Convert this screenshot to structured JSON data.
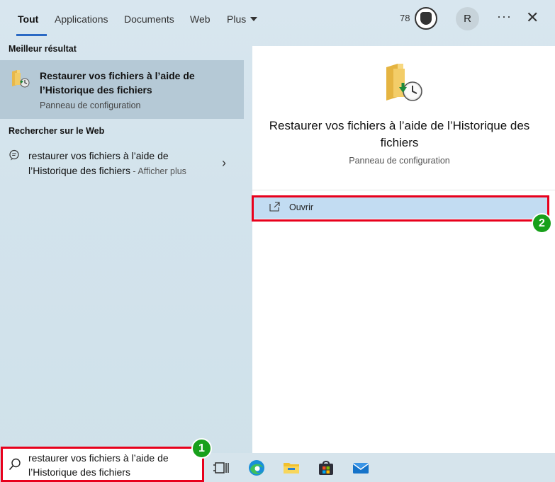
{
  "tabs": [
    {
      "label": "Tout"
    },
    {
      "label": "Applications"
    },
    {
      "label": "Documents"
    },
    {
      "label": "Web"
    },
    {
      "label": "Plus"
    }
  ],
  "header": {
    "points": "78",
    "avatar_initial": "R",
    "more_icon": "ellipsis-icon",
    "close_icon": "close-icon"
  },
  "best_match": {
    "section_label": "Meilleur résultat",
    "title": "Restaurer vos fichiers à l’aide de l’Historique des fichiers",
    "subtitle": "Panneau de configuration"
  },
  "web_search": {
    "section_label": "Rechercher sur le Web",
    "query_text": "restaurer vos fichiers à l’aide de l’Historique des fichiers",
    "more_label": " - Afficher plus"
  },
  "detail_panel": {
    "title": "Restaurer vos fichiers à l’aide de l’Historique des fichiers",
    "subtitle": "Panneau de configuration",
    "open_label": "Ouvrir"
  },
  "search_box": {
    "value": "restaurer vos fichiers à l’aide de l’Historique des fichiers"
  },
  "annotations": {
    "badge_1": "1",
    "badge_2": "2"
  },
  "colors": {
    "accent": "#2a69c4",
    "annotation_red": "#e8001c",
    "badge_green": "#18a01b",
    "selected_row": "#b5c9d6",
    "open_button": "#c2dcf2"
  },
  "taskbar": {
    "icons": [
      "task-view-icon",
      "edge-icon",
      "file-explorer-icon",
      "store-icon",
      "mail-icon"
    ]
  }
}
